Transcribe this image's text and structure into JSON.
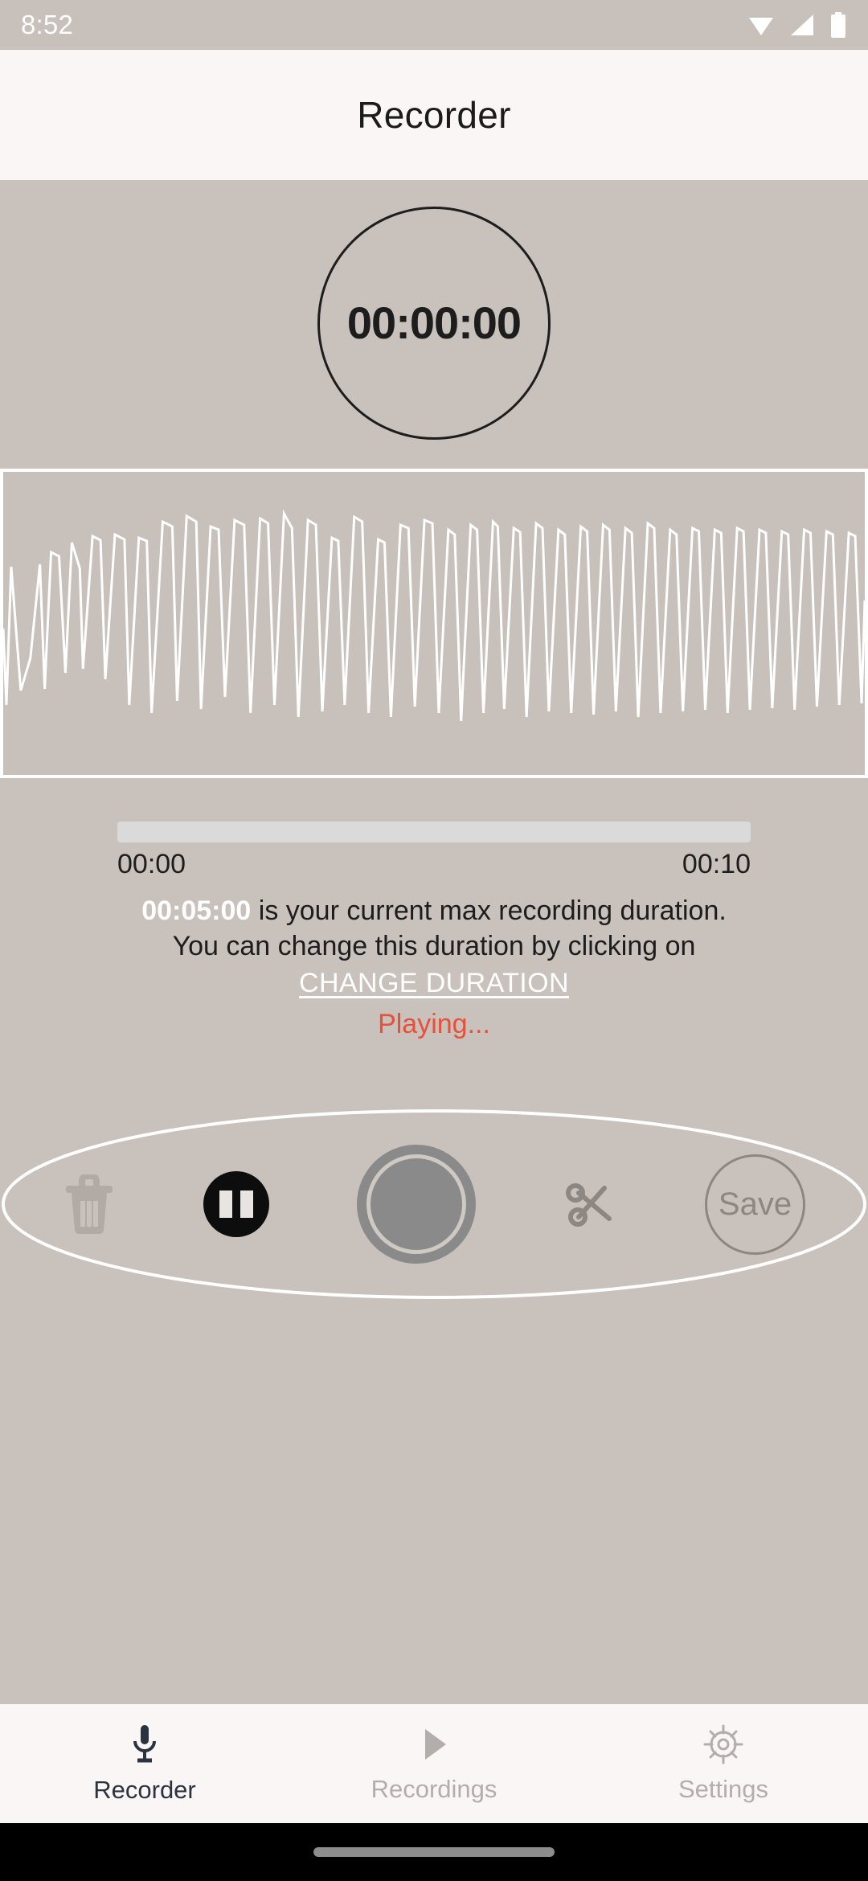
{
  "statusbar": {
    "time": "8:52",
    "icons": [
      "wifi-icon",
      "signal-icon",
      "battery-icon"
    ]
  },
  "appbar": {
    "title": "Recorder"
  },
  "timer": {
    "value": "00:00:00"
  },
  "waveform": {
    "label": "audio-waveform",
    "color": "#ffffff"
  },
  "progress": {
    "percent": 0,
    "start_time": "00:00",
    "end_time": "00:10"
  },
  "info": {
    "max_duration": "00:05:00",
    "sentence_part1": " is your current max recording duration.",
    "sentence_part2": "You can change this duration by clicking on",
    "change_link": "CHANGE DURATION",
    "status": "Playing...",
    "status_color": "#e8503a"
  },
  "controls": {
    "delete_label": "trash-icon",
    "pause_label": "pause-icon",
    "record_label": "record-icon",
    "cut_label": "scissors-icon",
    "save_label": "Save"
  },
  "bottomnav": {
    "items": [
      {
        "label": "Recorder",
        "icon": "microphone-icon",
        "active": true
      },
      {
        "label": "Recordings",
        "icon": "play-icon",
        "active": false
      },
      {
        "label": "Settings",
        "icon": "gear-icon",
        "active": false
      }
    ]
  },
  "colors": {
    "background": "#c8c1bc",
    "appbar": "#faf6f5",
    "accent_red": "#e8503a",
    "record_gray": "#8a8a8a",
    "nav_active": "#2b3240",
    "nav_idle": "#b3aeab"
  }
}
